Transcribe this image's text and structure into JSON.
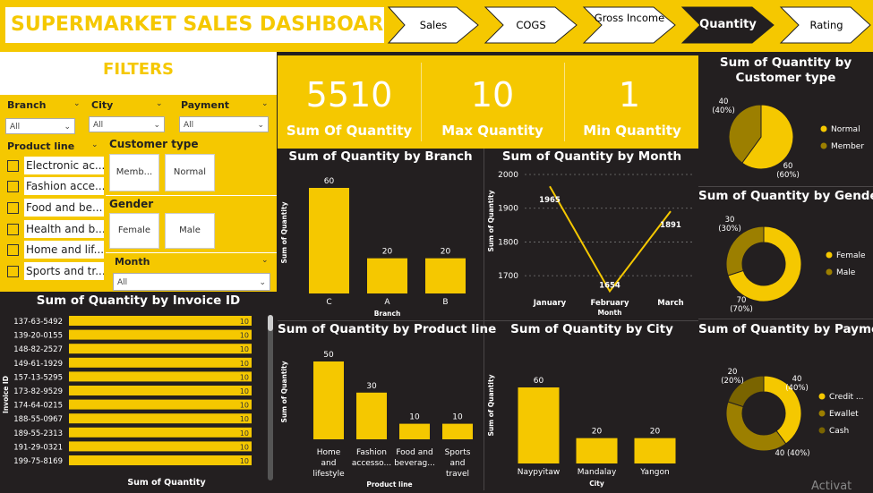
{
  "header": {
    "title": "SUPERMARKET SALES DASHBOARD"
  },
  "nav": {
    "tabs": [
      {
        "label": "Sales",
        "active": false
      },
      {
        "label": "COGS",
        "active": false
      },
      {
        "label": "Gross Income",
        "active": false
      },
      {
        "label": "Quantity",
        "active": true
      },
      {
        "label": "Rating",
        "active": false
      }
    ]
  },
  "filters": {
    "title": "FILTERS",
    "branch": {
      "label": "Branch",
      "value": "All"
    },
    "city": {
      "label": "City",
      "value": "All"
    },
    "payment": {
      "label": "Payment",
      "value": "All"
    },
    "product_line": {
      "label": "Product line",
      "items": [
        "Electronic ac...",
        "Fashion acce...",
        "Food and be...",
        "Health and b...",
        "Home and lif...",
        "Sports and tr..."
      ]
    },
    "customer_type": {
      "label": "Customer type",
      "options": [
        "Memb...",
        "Normal"
      ]
    },
    "gender": {
      "label": "Gender",
      "options": [
        "Female",
        "Male"
      ]
    },
    "month": {
      "label": "Month",
      "value": "All"
    }
  },
  "kpis": [
    {
      "value": "5510",
      "label": "Sum Of Quantity"
    },
    {
      "value": "10",
      "label": "Max Quantity"
    },
    {
      "value": "1",
      "label": "Min Quantity"
    }
  ],
  "colors": {
    "accent": "#f5c800",
    "background": "#231f20",
    "olive": "#9c7f00",
    "olive_dark": "#7a6400"
  },
  "chart_data": [
    {
      "type": "bar",
      "title": "Sum of Quantity by Branch",
      "categories": [
        "C",
        "A",
        "B"
      ],
      "values": [
        60,
        20,
        20
      ],
      "xlabel": "Branch",
      "ylabel": "Sum of Quantity",
      "ylim": [
        0,
        60
      ]
    },
    {
      "type": "line",
      "title": "Sum of Quantity by Month",
      "categories": [
        "January",
        "February",
        "March"
      ],
      "values": [
        1965,
        1654,
        1891
      ],
      "yticks": [
        "2000",
        "1900",
        "1800",
        "1700"
      ],
      "xlabel": "Month",
      "ylabel": "Sum of Quantity",
      "ylim": [
        1650,
        2000
      ]
    },
    {
      "type": "pie",
      "title": "Sum of Quantity by Customer type",
      "slices": [
        {
          "name": "Normal",
          "value": 60,
          "label": "60\n(60%)",
          "color": "#f5c800"
        },
        {
          "name": "Member",
          "value": 40,
          "label": "40\n(40%)",
          "color": "#9c7f00"
        }
      ]
    },
    {
      "type": "pie",
      "title": "Sum of Quantity by Gender",
      "donut": true,
      "slices": [
        {
          "name": "Female",
          "value": 70,
          "label": "70\n(70%)",
          "color": "#f5c800"
        },
        {
          "name": "Male",
          "value": 30,
          "label": "30\n(30%)",
          "color": "#9c7f00"
        }
      ]
    },
    {
      "type": "bar",
      "orientation": "horizontal",
      "title": "Sum of Quantity by Invoice ID",
      "categories": [
        "137-63-5492",
        "139-20-0155",
        "148-82-2527",
        "149-61-1929",
        "157-13-5295",
        "173-82-9529",
        "174-64-0215",
        "188-55-0967",
        "189-55-2313",
        "191-29-0321",
        "199-75-8169"
      ],
      "values": [
        10,
        10,
        10,
        10,
        10,
        10,
        10,
        10,
        10,
        10,
        10
      ],
      "xlabel": "Sum of Quantity",
      "ylabel": "Invoice ID"
    },
    {
      "type": "bar",
      "title": "Sum of Quantity by Product line",
      "categories": [
        "Home and lifestyle",
        "Fashion accesso...",
        "Food and beverag...",
        "Sports and travel"
      ],
      "values": [
        50,
        30,
        10,
        10
      ],
      "xlabel": "Product line",
      "ylabel": "Sum of Quantity",
      "ylim": [
        0,
        50
      ]
    },
    {
      "type": "bar",
      "title": "Sum of Quantity by City",
      "categories": [
        "Naypyitaw",
        "Mandalay",
        "Yangon"
      ],
      "values": [
        60,
        20,
        20
      ],
      "xlabel": "City",
      "ylabel": "Sum of Quantity",
      "ylim": [
        0,
        60
      ]
    },
    {
      "type": "pie",
      "title": "Sum of Quantity by Payment",
      "donut": true,
      "slices": [
        {
          "name": "Credit ...",
          "value": 40,
          "label": "40\n(40%)",
          "color": "#f5c800"
        },
        {
          "name": "Ewallet",
          "value": 40,
          "label": "40 (40%)",
          "color": "#9c7f00"
        },
        {
          "name": "Cash",
          "value": 20,
          "label": "20\n(20%)",
          "color": "#7a6400"
        }
      ]
    }
  ],
  "watermark": "Activat"
}
